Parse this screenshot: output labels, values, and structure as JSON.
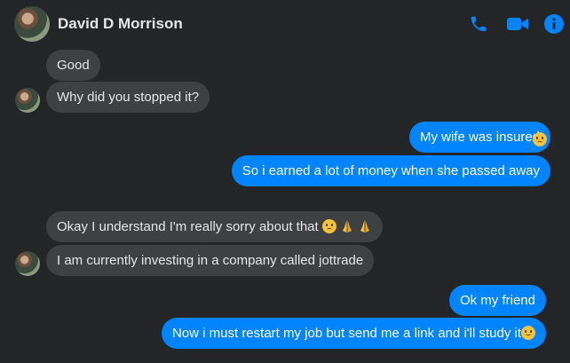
{
  "contact": {
    "name": "David D Morrison"
  },
  "header": {
    "icons": [
      "phone-icon",
      "video-camera-icon",
      "info-icon"
    ]
  },
  "colors": {
    "accent": "#0084ff",
    "incoming_bubble": "#3e4042",
    "background": "#242526"
  },
  "messages": [
    {
      "from": "them",
      "text": "Good"
    },
    {
      "from": "them",
      "text": "Why did you stopped it?"
    },
    {
      "from": "me",
      "text": "My wife was insured"
    },
    {
      "from": "me",
      "text": "So i earned a lot of money when she passed away",
      "reaction": "sad-face"
    },
    {
      "from": "them",
      "text": "Okay I understand I'm really sorry about that",
      "emojis": [
        "sad-face",
        "folded-hands",
        "folded-hands"
      ]
    },
    {
      "from": "them",
      "text": "I am currently investing in a company called jottrade"
    },
    {
      "from": "me",
      "text": "Ok my friend"
    },
    {
      "from": "me",
      "text": "Now i must restart my job but send me a link and i'll study it",
      "emojis": [
        "smiling-face"
      ]
    }
  ]
}
